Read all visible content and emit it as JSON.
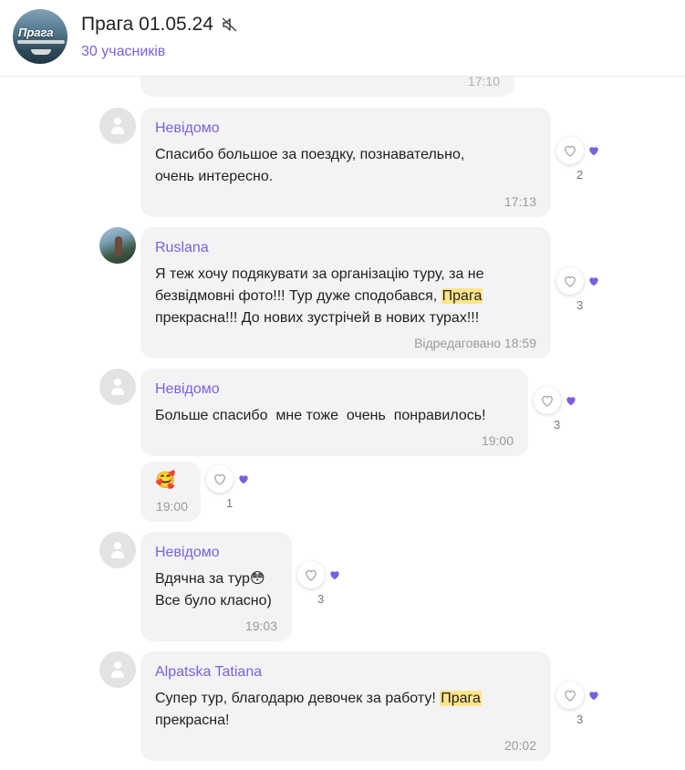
{
  "header": {
    "title": "Прага 01.05.24",
    "members": "30 учасників",
    "avatar_text": "Прага"
  },
  "colors": {
    "accent": "#7b5fe0",
    "bubble": "#f3f3f5",
    "highlight": "#ffe58a"
  },
  "icons": {
    "mute": "muted-speaker-icon",
    "react": "heart-outline-icon",
    "liked": "heart-filled-icon"
  },
  "messages": [
    {
      "time": "17:10"
    },
    {
      "sender": "Невідомо",
      "line1": "Спасибо большое за поездку, познавательно,",
      "line2": "очень интересно.",
      "time": "17:13",
      "reactions": "2"
    },
    {
      "sender": "Ruslana",
      "line1": "Я теж хочу подякувати за організацію туру, за не",
      "line2a": "безвідмовні фото!!! Тур дуже сподобався, ",
      "line2hl": "Прага",
      "line3": "прекрасна!!! До нових зустрічей в нових турах!!!",
      "time": "Відредаговано 18:59",
      "reactions": "3"
    },
    {
      "sender": "Невідомо",
      "line1": "Больше спасибо  мне тоже  очень  понравилось!",
      "time": "19:00",
      "reactions": "3"
    },
    {
      "emoji": "🥰",
      "time": "19:00",
      "reactions": "1"
    },
    {
      "sender": "Невідомо",
      "line1": "Вдячна за тур😳",
      "line2": "Все було класно)",
      "time": "19:03",
      "reactions": "3"
    },
    {
      "sender": "Alpatska Tatiana",
      "line1a": "Супер тур, благодарю девочек за работу! ",
      "line1hl": "Прага",
      "line2": "прекрасна!",
      "time": "20:02",
      "reactions": "3"
    }
  ]
}
